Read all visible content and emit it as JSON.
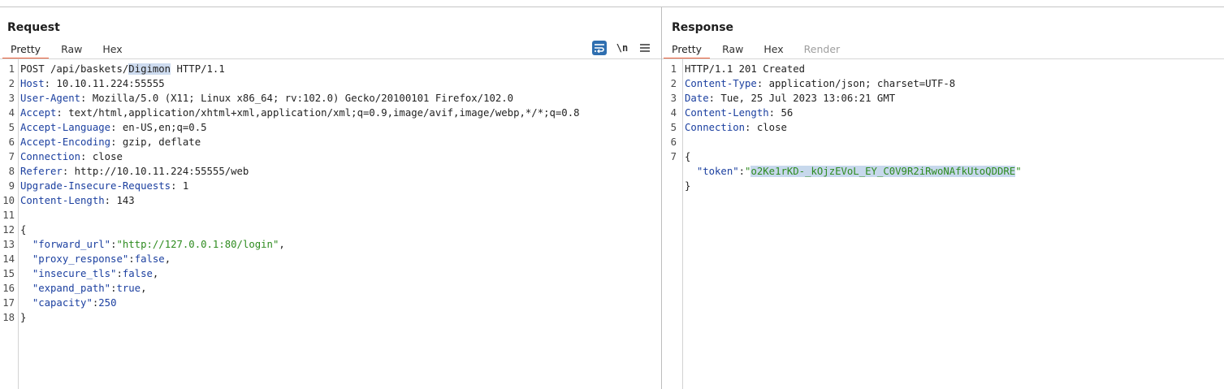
{
  "request": {
    "title": "Request",
    "tabs": [
      "Pretty",
      "Raw",
      "Hex"
    ],
    "toolbar": {
      "wrap_icon": "wrap-lines-icon",
      "newline_label": "\\n",
      "menu_icon": "hamburger-menu-icon"
    },
    "line_numbers": [
      "1",
      "2",
      "3",
      "4",
      "5",
      "6",
      "7",
      "8",
      "9",
      "10",
      "11",
      "12",
      "13",
      "14",
      "15",
      "16",
      "17",
      "18"
    ],
    "request_line": {
      "prefix": "POST /api/baskets/",
      "selected": "Digimon",
      "suffix": " HTTP/1.1"
    },
    "headers": [
      {
        "name": "Host",
        "value": ": 10.10.11.224:55555"
      },
      {
        "name": "User-Agent",
        "value": ": Mozilla/5.0 (X11; Linux x86_64; rv:102.0) Gecko/20100101 Firefox/102.0"
      },
      {
        "name": "Accept",
        "value": ": text/html,application/xhtml+xml,application/xml;q=0.9,image/avif,image/webp,*/*;q=0.8"
      },
      {
        "name": "Accept-Language",
        "value": ": en-US,en;q=0.5"
      },
      {
        "name": "Accept-Encoding",
        "value": ": gzip, deflate"
      },
      {
        "name": "Connection",
        "value": ": close"
      },
      {
        "name": "Referer",
        "value": ": http://10.10.11.224:55555/web"
      },
      {
        "name": "Upgrade-Insecure-Requests",
        "value": ": 1"
      },
      {
        "name": "Content-Length",
        "value": ": 143"
      }
    ],
    "body": {
      "open": "{",
      "close": "}",
      "fields": [
        {
          "key": "\"forward_url\"",
          "sep": ":",
          "val": "\"http://127.0.0.1:80/login\"",
          "end": ","
        },
        {
          "key": "\"proxy_response\"",
          "sep": ":",
          "val": "false",
          "end": ","
        },
        {
          "key": "\"insecure_tls\"",
          "sep": ":",
          "val": "false",
          "end": ","
        },
        {
          "key": "\"expand_path\"",
          "sep": ":",
          "val": "true",
          "end": ","
        },
        {
          "key": "\"capacity\"",
          "sep": ":",
          "val": "250",
          "end": ""
        }
      ]
    }
  },
  "response": {
    "title": "Response",
    "tabs": [
      "Pretty",
      "Raw",
      "Hex",
      "Render"
    ],
    "line_numbers": [
      "1",
      "2",
      "3",
      "4",
      "5",
      "6",
      "7"
    ],
    "status_line": "HTTP/1.1 201 Created",
    "headers": [
      {
        "name": "Content-Type",
        "value": ": application/json; charset=UTF-8"
      },
      {
        "name": "Date",
        "value": ": Tue, 25 Jul 2023 13:06:21 GMT"
      },
      {
        "name": "Content-Length",
        "value": ": 56"
      },
      {
        "name": "Connection",
        "value": ": close"
      }
    ],
    "body": {
      "open": "{",
      "close": "}",
      "key": "\"token\"",
      "sep": ":",
      "quote": "\"",
      "token": "o2Ke1rKD-_kOjzEVoL_EY_C0V9R2iRwoNAfkUtoQDDRE"
    }
  },
  "colors": {
    "accent_tab": "#e8603c",
    "header_name": "#1c40a0",
    "string": "#2e8b1f",
    "selection": "#cddbef",
    "toggle_on": "#2f6fb0"
  }
}
